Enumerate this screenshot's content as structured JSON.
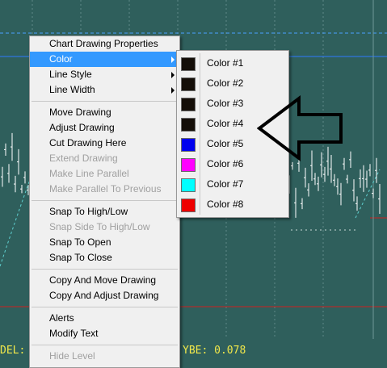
{
  "main_menu": {
    "groups": [
      [
        {
          "label": "Chart Drawing Properties",
          "state": "normal"
        },
        {
          "label": "Color",
          "state": "highlighted",
          "submenu": true
        },
        {
          "label": "Line Style",
          "state": "normal",
          "submenu": true
        },
        {
          "label": "Line Width",
          "state": "normal",
          "submenu": true
        }
      ],
      [
        {
          "label": "Move Drawing",
          "state": "normal"
        },
        {
          "label": "Adjust Drawing",
          "state": "normal"
        },
        {
          "label": "Cut Drawing Here",
          "state": "normal"
        },
        {
          "label": "Extend Drawing",
          "state": "disabled"
        },
        {
          "label": "Make Line Parallel",
          "state": "disabled"
        },
        {
          "label": "Make Parallel To Previous",
          "state": "disabled"
        }
      ],
      [
        {
          "label": "Snap To High/Low",
          "state": "normal"
        },
        {
          "label": "Snap Side To High/Low",
          "state": "disabled"
        },
        {
          "label": "Snap To Open",
          "state": "normal"
        },
        {
          "label": "Snap To Close",
          "state": "normal"
        }
      ],
      [
        {
          "label": "Copy And Move Drawing",
          "state": "normal"
        },
        {
          "label": "Copy And Adjust Drawing",
          "state": "normal"
        }
      ],
      [
        {
          "label": "Alerts",
          "state": "normal"
        },
        {
          "label": "Modify Text",
          "state": "normal"
        }
      ],
      [
        {
          "label": "Hide Level",
          "state": "disabled"
        }
      ]
    ]
  },
  "color_submenu": {
    "items": [
      {
        "label": "Color #1",
        "swatch": "#140e08"
      },
      {
        "label": "Color #2",
        "swatch": "#140e08"
      },
      {
        "label": "Color #3",
        "swatch": "#140e08"
      },
      {
        "label": "Color #4",
        "swatch": "#140e08"
      },
      {
        "label": "Color #5",
        "swatch": "#0000ee"
      },
      {
        "label": "Color #6",
        "swatch": "#ff00ff"
      },
      {
        "label": "Color #7",
        "swatch": "#00ffff"
      },
      {
        "label": "Color #8",
        "swatch": "#ee0000"
      }
    ]
  },
  "status_bar": {
    "left_text": "DEL:",
    "right_text": "YBE: 0.078"
  },
  "theme": {
    "chart_background": "#2f5f5c",
    "status_text_color": "#f2e84a",
    "highlight_color": "#3399ff"
  },
  "annotation": {
    "icon": "hollow-left-arrow-icon"
  }
}
